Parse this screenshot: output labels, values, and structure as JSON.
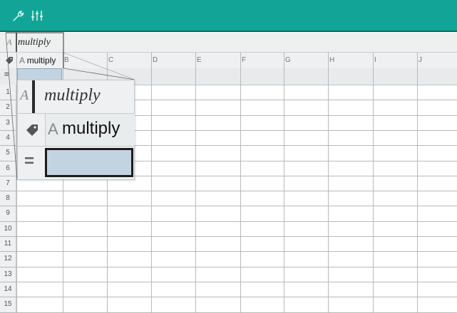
{
  "toolbar": {
    "background": "#12a597",
    "icons": [
      "wrench-icon",
      "sliders-icon"
    ]
  },
  "entry_line": {
    "cell_ref": "A",
    "text": "multiply"
  },
  "columns": [
    "A",
    "B",
    "C",
    "D",
    "E",
    "F",
    "G",
    "H",
    "I",
    "J"
  ],
  "column_A_name": "multiply",
  "row_numbers": [
    "1",
    "2",
    "3",
    "4",
    "5",
    "6",
    "7",
    "8",
    "9",
    "10",
    "11",
    "12",
    "13",
    "14",
    "15"
  ],
  "formula_symbol": "=",
  "magnifier": {
    "cell_ref": "A",
    "name_italic": "multiply",
    "col_letter": "A",
    "col_name": "multiply",
    "formula_symbol": "="
  },
  "colors": {
    "accent": "#12a597",
    "selection": "#c2d4e1",
    "header_bg": "#eef0f1"
  }
}
